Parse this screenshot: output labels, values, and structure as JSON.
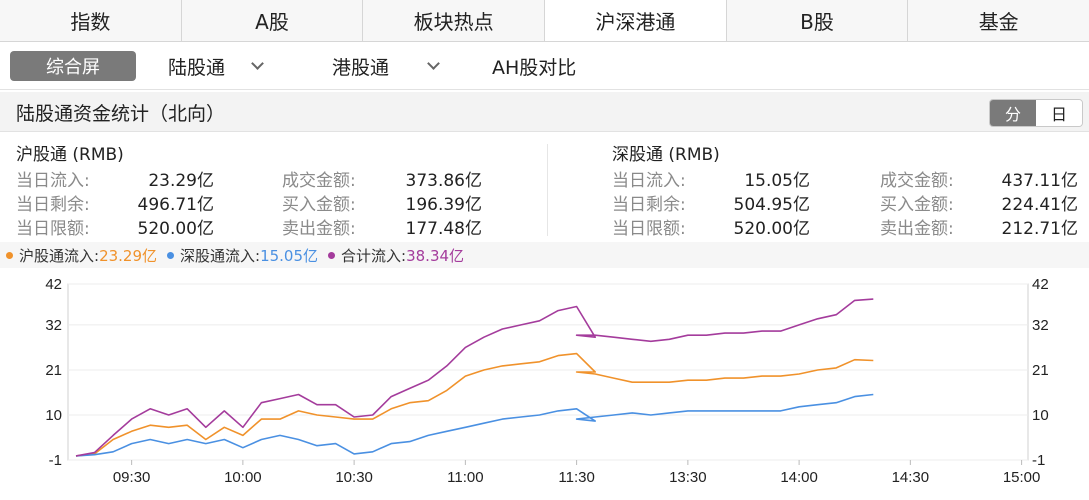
{
  "tabs": [
    "指数",
    "A股",
    "板块热点",
    "沪深港通",
    "B股",
    "基金"
  ],
  "subnav": {
    "active": "综合屏",
    "items": [
      "陆股通",
      "港股通",
      "AH股对比"
    ]
  },
  "panel": {
    "title": "陆股通资金统计（北向）",
    "seg": [
      "分",
      "日"
    ]
  },
  "sh": {
    "header": "沪股通 (RMB)",
    "rows": [
      {
        "l1": "当日流入:",
        "v1": "23.29亿",
        "l2": "成交金额:",
        "v2": "373.86亿"
      },
      {
        "l1": "当日剩余:",
        "v1": "496.71亿",
        "l2": "买入金额:",
        "v2": "196.39亿"
      },
      {
        "l1": "当日限额:",
        "v1": "520.00亿",
        "l2": "卖出金额:",
        "v2": "177.48亿"
      }
    ]
  },
  "sz": {
    "header": "深股通 (RMB)",
    "rows": [
      {
        "l1": "当日流入:",
        "v1": "15.05亿",
        "l2": "成交金额:",
        "v2": "437.11亿"
      },
      {
        "l1": "当日剩余:",
        "v1": "504.95亿",
        "l2": "买入金额:",
        "v2": "224.41亿"
      },
      {
        "l1": "当日限额:",
        "v1": "520.00亿",
        "l2": "卖出金额:",
        "v2": "212.71亿"
      }
    ]
  },
  "legend": [
    {
      "name": "沪股通流入:",
      "value": "23.29亿",
      "color": "#f0922b"
    },
    {
      "name": "深股通流入:",
      "value": "15.05亿",
      "color": "#4a90e2"
    },
    {
      "name": "合计流入:",
      "value": "38.34亿",
      "color": "#a43c9c"
    }
  ],
  "chart_data": {
    "type": "line",
    "x_ticks": [
      "09:30",
      "10:00",
      "10:30",
      "11:00",
      "11:30",
      "13:30",
      "14:00",
      "14:30",
      "15:00"
    ],
    "y_ticks": [
      42,
      32,
      21,
      10,
      -1
    ],
    "ylim": [
      -1,
      42
    ],
    "x": [
      "09:15",
      "09:20",
      "09:25",
      "09:30",
      "09:35",
      "09:40",
      "09:45",
      "09:50",
      "09:55",
      "10:00",
      "10:05",
      "10:10",
      "10:15",
      "10:20",
      "10:25",
      "10:30",
      "10:35",
      "10:40",
      "10:45",
      "10:50",
      "10:55",
      "11:00",
      "11:05",
      "11:10",
      "11:15",
      "11:20",
      "11:25",
      "11:30",
      "11:35",
      "13:00",
      "13:05",
      "13:10",
      "13:15",
      "13:20",
      "13:25",
      "13:30",
      "13:35",
      "13:40",
      "13:45",
      "13:50",
      "13:55",
      "14:00",
      "14:05",
      "14:10",
      "14:15",
      "14:20"
    ],
    "series": [
      {
        "name": "沪股通流入",
        "color": "#f0922b",
        "values": [
          0,
          0.5,
          4,
          6,
          7.5,
          7,
          7.5,
          4,
          7,
          5,
          9,
          9,
          11,
          10,
          9.5,
          9,
          9,
          11.5,
          13,
          13.5,
          16,
          19.5,
          21,
          22,
          22.5,
          23,
          24.5,
          25,
          20.5,
          20.5,
          20,
          19,
          18,
          18,
          18,
          18.5,
          18.5,
          19,
          19,
          19.5,
          19.5,
          20,
          21,
          21.5,
          23.5,
          23.3
        ]
      },
      {
        "name": "深股通流入",
        "color": "#4a90e2",
        "values": [
          0,
          0.3,
          1,
          3,
          4,
          3,
          4,
          3,
          4,
          2,
          4,
          5,
          4,
          2.5,
          3,
          0.5,
          1,
          3,
          3.5,
          5,
          6,
          7,
          8,
          9,
          9.5,
          10,
          11,
          11.5,
          8.5,
          9,
          9.5,
          10,
          10.5,
          10,
          10.5,
          11,
          11,
          11,
          11,
          11,
          11,
          12,
          12.5,
          13,
          14.5,
          15
        ]
      },
      {
        "name": "合计流入",
        "color": "#a43c9c",
        "values": [
          0,
          0.8,
          5,
          9,
          11.5,
          10,
          11.5,
          7,
          11,
          7,
          13,
          14,
          15,
          12.5,
          12.5,
          9.5,
          10,
          14.5,
          16.5,
          18.5,
          22,
          26.5,
          29,
          31,
          32,
          33,
          35.5,
          36.5,
          29,
          29.5,
          29.5,
          29,
          28.5,
          28,
          28.5,
          29.5,
          29.5,
          30,
          30,
          30.5,
          30.5,
          32,
          33.5,
          34.5,
          38,
          38.3
        ]
      }
    ]
  }
}
